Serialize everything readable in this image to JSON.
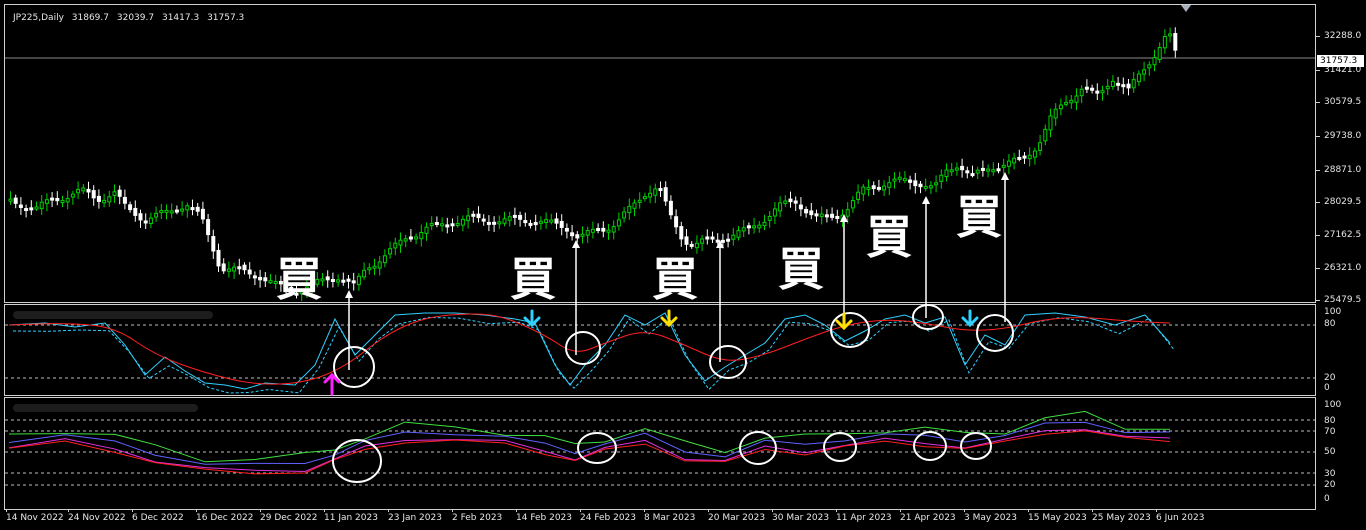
{
  "window": {
    "symbol": "JP225,Daily",
    "open": "31869.7",
    "high": "32039.7",
    "low": "31417.3",
    "close": "31757.3"
  },
  "price_axis": [
    "32288.0",
    "31421.0",
    "30579.5",
    "29738.0",
    "28871.0",
    "28029.5",
    "27162.5",
    "26321.0",
    "25479.5"
  ],
  "current_price": "31757.3",
  "indicator1_axis": [
    "100",
    "80",
    "20",
    "0"
  ],
  "indicator2_axis": [
    "100",
    "80",
    "70",
    "50",
    "30",
    "20",
    "0"
  ],
  "date_axis": [
    "14 Nov 2022",
    "24 Nov 2022",
    "6 Dec 2022",
    "16 Dec 2022",
    "29 Dec 2022",
    "11 Jan 2023",
    "23 Jan 2023",
    "2 Feb 2023",
    "14 Feb 2023",
    "24 Feb 2023",
    "8 Mar 2023",
    "20 Mar 2023",
    "30 Mar 2023",
    "11 Apr 2023",
    "21 Apr 2023",
    "3 May 2023",
    "15 May 2023",
    "25 May 2023",
    "6 Jun 2023"
  ],
  "annotations": {
    "buy_label": "買",
    "buy_count": 6
  },
  "colors": {
    "background": "#000000",
    "candle_up": "#00d000",
    "candle_down": "#ffffff",
    "signal_line": "#ff2020",
    "stoch_line": "#30d0ff",
    "ind2_green": "#40e040",
    "ind2_blue": "#6060ff",
    "ind2_magenta": "#e030e0",
    "arrow_magenta": "#ff20ff",
    "arrow_cyan": "#30d0ff",
    "arrow_yellow": "#ffe000"
  },
  "chart_data": {
    "type": "candlestick",
    "x": [
      "14 Nov 2022",
      "24 Nov 2022",
      "6 Dec 2022",
      "16 Dec 2022",
      "29 Dec 2022",
      "11 Jan 2023",
      "23 Jan 2023",
      "2 Feb 2023",
      "14 Feb 2023",
      "24 Feb 2023",
      "8 Mar 2023",
      "20 Mar 2023",
      "30 Mar 2023",
      "11 Apr 2023",
      "21 Apr 2023",
      "3 May 2023",
      "15 May 2023",
      "25 May 2023",
      "6 Jun 2023"
    ],
    "close": [
      28150,
      28350,
      28000,
      27250,
      26150,
      26300,
      27350,
      27450,
      27550,
      27400,
      28100,
      27250,
      27800,
      28300,
      28600,
      28950,
      30600,
      30900,
      31757.3
    ],
    "ylim": [
      25479.5,
      32450
    ],
    "current_price": 31757.3
  }
}
